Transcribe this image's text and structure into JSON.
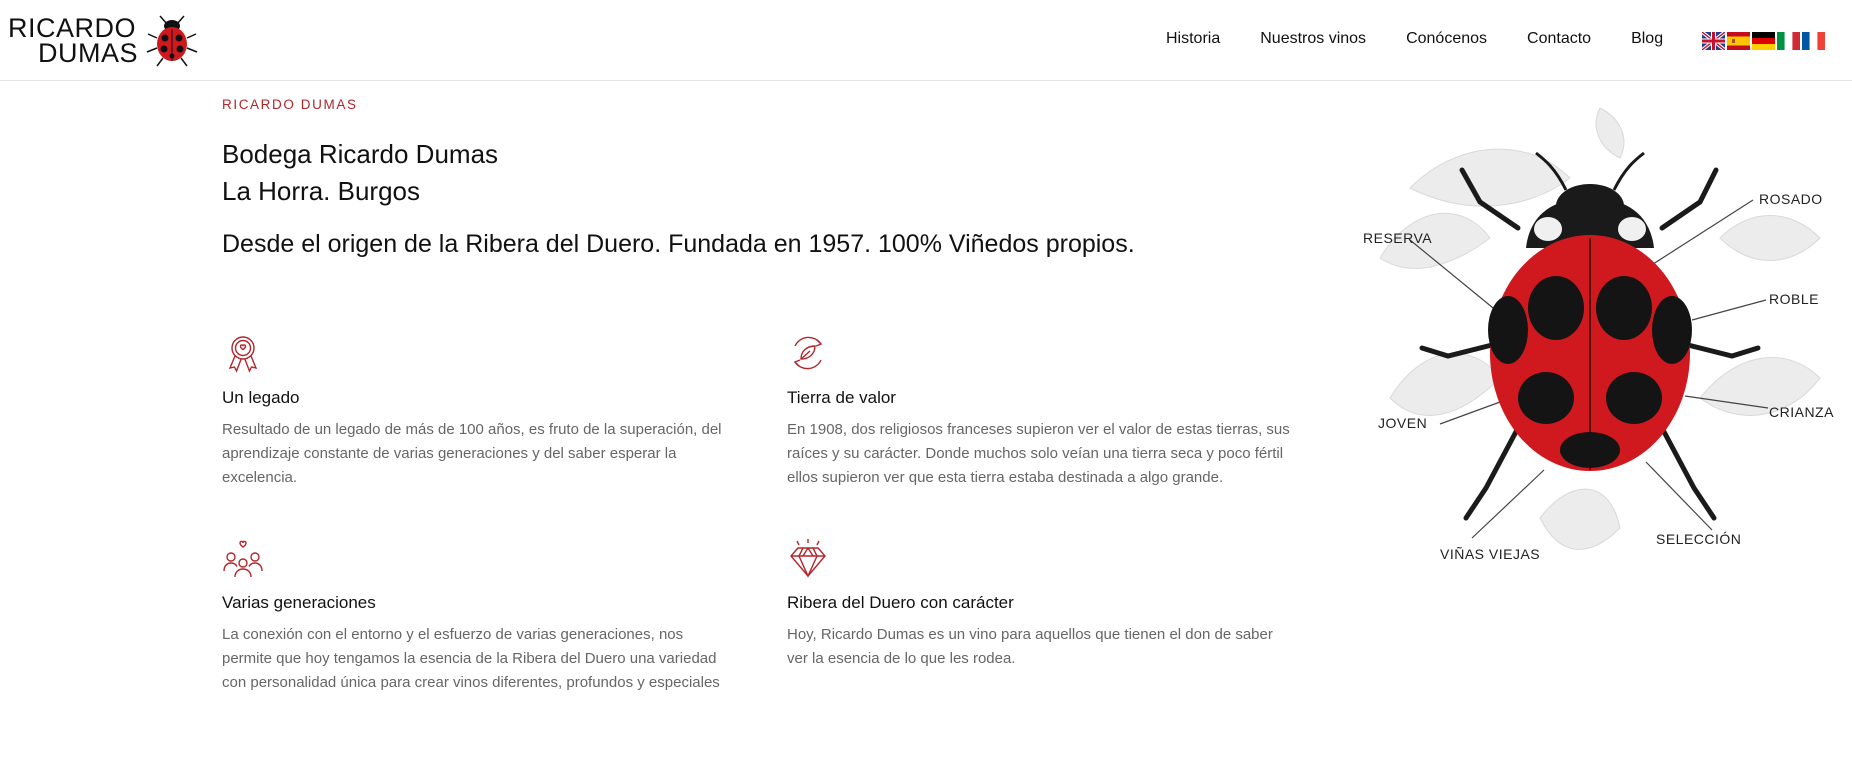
{
  "brand": {
    "logo_line1": "RICARDO",
    "logo_line2": "DUMAS"
  },
  "nav": {
    "items": [
      "Historia",
      "Nuestros vinos",
      "Conócenos",
      "Contacto",
      "Blog"
    ]
  },
  "languages": [
    "en",
    "es",
    "de",
    "it",
    "fr"
  ],
  "hero": {
    "eyebrow": "RICARDO DUMAS",
    "title_line1": "Bodega Ricardo Dumas",
    "title_line2": "La Horra. Burgos",
    "tagline": "Desde el origen de la Ribera del Duero. Fundada en 1957. 100% Viñedos propios."
  },
  "features": [
    {
      "icon": "award-ribbon-icon",
      "title": "Un legado",
      "text": "Resultado de un legado de más de 100 años, es fruto de la superación, del aprendizaje constante de varias generaciones y del saber esperar la excelencia."
    },
    {
      "icon": "leaf-cycle-icon",
      "title": "Tierra de valor",
      "text": "En 1908, dos religiosos franceses supieron ver el valor de estas tierras, sus raíces y su carácter. Donde muchos solo veían una tierra seca y poco fértil ellos supieron ver que esta tierra estaba destinada a algo grande."
    },
    {
      "icon": "people-heart-icon",
      "title": "Varias generaciones",
      "text": "La conexión con el entorno y el esfuerzo de varias generaciones, nos permite que hoy tengamos la esencia de la Ribera del Duero una variedad con personalidad única para crear vinos diferentes, profundos y especiales"
    },
    {
      "icon": "diamond-icon",
      "title": "Ribera del Duero con carácter",
      "text": "Hoy, Ricardo Dumas es un vino para aquellos que tienen el don de saber ver la esencia de lo que les rodea."
    }
  ],
  "illustration": {
    "labels": {
      "reserva": "RESERVA",
      "rosado": "ROSADO",
      "roble": "ROBLE",
      "crianza": "CRIANZA",
      "joven": "JOVEN",
      "vinas_viejas": "VIÑAS VIEJAS",
      "seleccion": "SELECCIÓN"
    }
  },
  "colors": {
    "accent": "#b3252b",
    "ladybug_red": "#d0191e",
    "text": "#111111",
    "muted": "#666666"
  }
}
